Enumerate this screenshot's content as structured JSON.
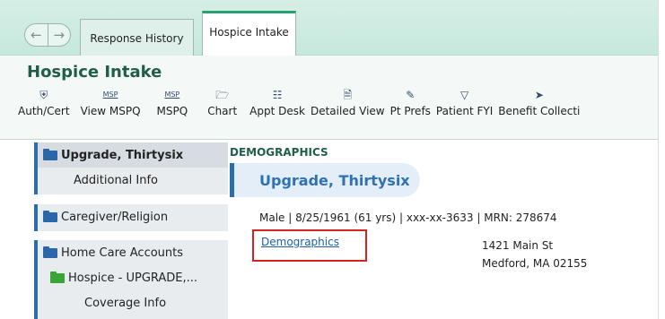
{
  "tabs": {
    "response_history": "Response History",
    "hospice_intake": "Hospice Intake"
  },
  "activity": {
    "title": "Hospice Intake",
    "toolbar": [
      {
        "icon": "shield-icon",
        "label": "Auth/Cert"
      },
      {
        "icon": "msp-icon",
        "icon_text": "MSP",
        "label": "View MSPQ"
      },
      {
        "icon": "msp-icon",
        "icon_text": "MSP",
        "label": "MSPQ"
      },
      {
        "icon": "folder-icon",
        "label": "Chart"
      },
      {
        "icon": "network-icon",
        "label": "Appt Desk"
      },
      {
        "icon": "document-export-icon",
        "label": "Detailed View"
      },
      {
        "icon": "pencil-icon",
        "label": "Pt Prefs"
      },
      {
        "icon": "filter-icon",
        "label": "Patient FYI"
      },
      {
        "icon": "pin-icon",
        "label": "Benefit Collecti"
      }
    ]
  },
  "sidebar": {
    "patient_name": "Upgrade, Thirtysix",
    "additional_info": "Additional Info",
    "caregiver": "Caregiver/Religion",
    "home_care": "Home Care Accounts",
    "hospice_account": "Hospice - UPGRADE,...",
    "coverage_info": "Coverage Info"
  },
  "main": {
    "section": "DEMOGRAPHICS",
    "name": "Upgrade, Thirtysix",
    "summary": "Male | 8/25/1961 (61 yrs) | xxx-xx-3633 | MRN: 278674",
    "demographics_link": "Demographics",
    "address_line1": "1421 Main St",
    "address_line2": "Medford, MA 02155"
  },
  "colors": {
    "accent_green": "#27a16f",
    "title_green": "#1f5e48",
    "link_blue": "#1e5ea8",
    "highlight_red": "#d42323"
  }
}
